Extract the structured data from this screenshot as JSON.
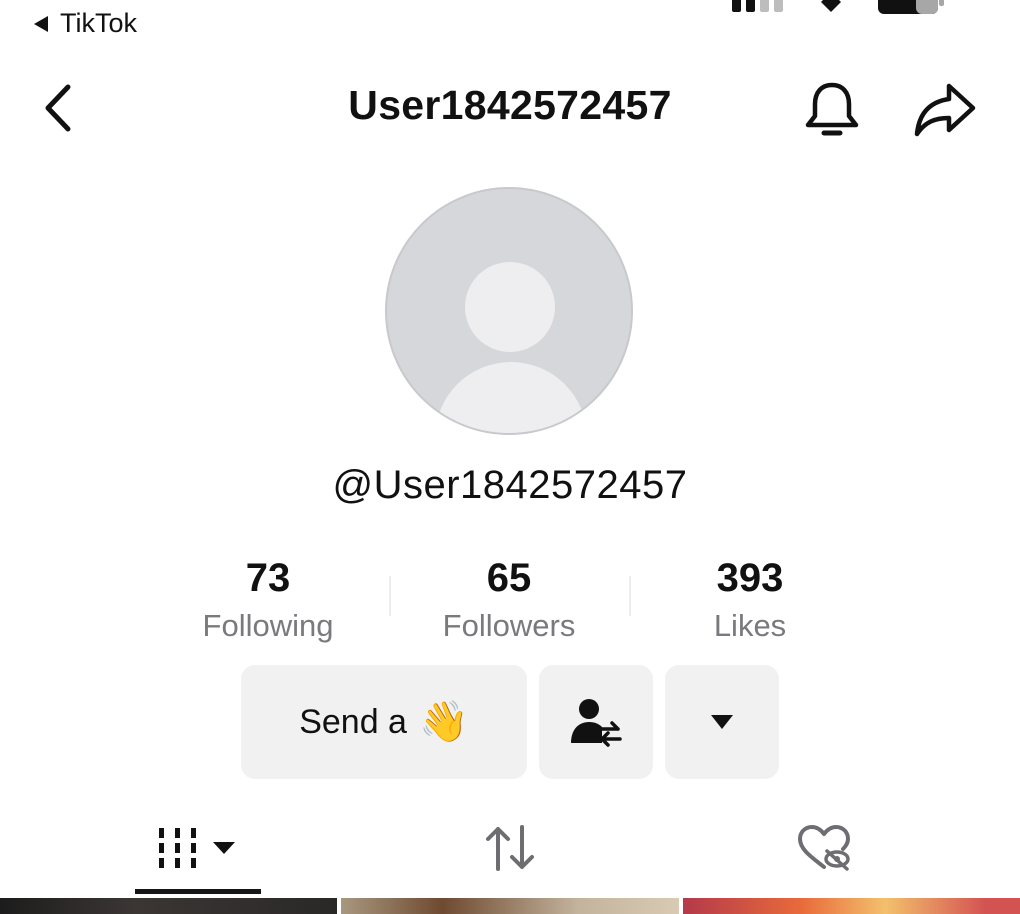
{
  "status_bar": {
    "back_app_label": "TikTok"
  },
  "header": {
    "title": "User1842572457",
    "icons": [
      "back-chevron-icon",
      "bell-icon",
      "share-arrow-icon"
    ]
  },
  "profile": {
    "handle": "@User1842572457",
    "avatar": "default-avatar"
  },
  "stats": [
    {
      "value": "73",
      "label": "Following"
    },
    {
      "value": "65",
      "label": "Followers"
    },
    {
      "value": "393",
      "label": "Likes"
    }
  ],
  "actions": {
    "send_label": "Send a",
    "send_emoji": "👋",
    "friends_icon": "suggested-accounts-icon",
    "more_icon": "dropdown-triangle-icon"
  },
  "tabs": [
    {
      "name": "videos",
      "icon": "grid-icon",
      "selected": true
    },
    {
      "name": "reposts",
      "icon": "repost-icon",
      "selected": false
    },
    {
      "name": "liked",
      "icon": "private-heart-icon",
      "selected": false
    }
  ],
  "colors": {
    "text": "#111111",
    "secondary_text": "#7a7a7e",
    "button_bg": "#f1f1f2",
    "avatar_bg": "#d6d7db"
  }
}
